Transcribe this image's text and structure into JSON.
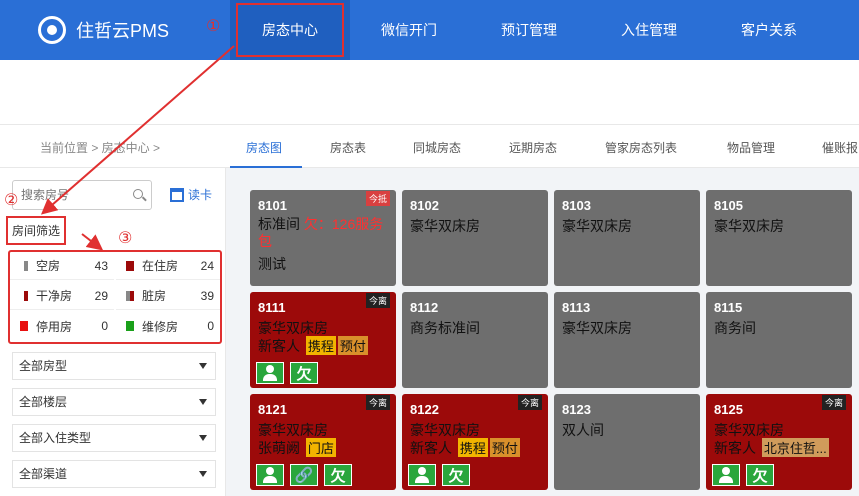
{
  "app": {
    "name": "住哲云PMS"
  },
  "nav": {
    "items": [
      "房态中心",
      "微信开门",
      "预订管理",
      "入住管理",
      "客户关系"
    ]
  },
  "breadcrumb": {
    "text": "当前位置 > 房态中心 >"
  },
  "tabs": [
    "房态图",
    "房态表",
    "同城房态",
    "远期房态",
    "管家房态列表",
    "物品管理",
    "催账报"
  ],
  "sidebar": {
    "search_placeholder": "搜索房号",
    "card_label": "读卡",
    "filter_label": "房间筛选",
    "statuses": [
      {
        "label": "空房",
        "count": "43",
        "color": "#888888"
      },
      {
        "label": "在住房",
        "count": "24",
        "color": "#9c0a0a"
      },
      {
        "label": "干净房",
        "count": "29",
        "color": "#9c0a0a"
      },
      {
        "label": "脏房",
        "count": "39",
        "color": "#888888"
      },
      {
        "label": "停用房",
        "count": "0",
        "color": "#e81010"
      },
      {
        "label": "维修房",
        "count": "0",
        "color": "#1aa01a"
      }
    ],
    "dropdowns": [
      "全部房型",
      "全部楼层",
      "全部入住类型",
      "全部渠道"
    ]
  },
  "annotations": [
    "①",
    "②",
    "③"
  ],
  "rooms": [
    {
      "num": "8101",
      "type": "标准间",
      "debt": "欠：126服务包",
      "note": "测试",
      "badge": "今抵",
      "status": "gray"
    },
    {
      "num": "8102",
      "type": "豪华双床房",
      "status": "gray"
    },
    {
      "num": "8103",
      "type": "豪华双床房",
      "status": "gray"
    },
    {
      "num": "8105",
      "type": "豪华双床房",
      "status": "gray"
    },
    {
      "num": "8111",
      "type": "豪华双床房",
      "guest": "新客人",
      "tags": [
        "携程",
        "预付"
      ],
      "badge": "今离",
      "status": "red",
      "icons": [
        "person",
        "欠"
      ]
    },
    {
      "num": "8112",
      "type": "商务标准间",
      "status": "gray"
    },
    {
      "num": "8113",
      "type": "豪华双床房",
      "status": "gray"
    },
    {
      "num": "8115",
      "type": "商务间",
      "status": "gray"
    },
    {
      "num": "8121",
      "type": "豪华双床房",
      "guest": "张萌阙",
      "tags": [
        "门店"
      ],
      "badge": "今离",
      "status": "red",
      "icons": [
        "person",
        "link",
        "欠"
      ]
    },
    {
      "num": "8122",
      "type": "豪华双床房",
      "guest": "新客人",
      "tags": [
        "携程",
        "预付"
      ],
      "badge": "今离",
      "status": "red",
      "icons": [
        "person",
        "欠"
      ]
    },
    {
      "num": "8123",
      "type": "双人间",
      "status": "gray"
    },
    {
      "num": "8125",
      "type": "豪华双床房",
      "guest": "新客人",
      "tags": [
        "北京住哲..."
      ],
      "badge": "今离",
      "status": "red",
      "icons": [
        "person",
        "欠"
      ]
    }
  ]
}
